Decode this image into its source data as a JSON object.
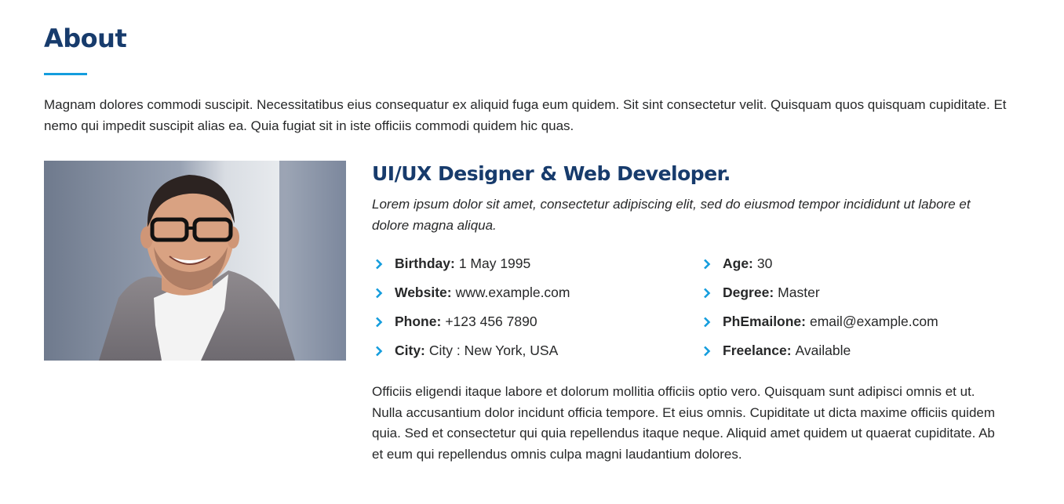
{
  "about": {
    "title": "About",
    "intro": "Magnam dolores commodi suscipit. Necessitatibus eius consequatur ex aliquid fuga eum quidem. Sit sint consectetur velit. Quisquam quos quisquam cupiditate. Et nemo qui impedit suscipit alias ea. Quia fugiat sit in iste officiis commodi quidem hic quas.",
    "role_title": "UI/UX Designer & Web Developer.",
    "role_lead": "Lorem ipsum dolor sit amet, consectetur adipiscing elit, sed do eiusmod tempor incididunt ut labore et dolore magna aliqua.",
    "details_left": [
      {
        "label": "Birthday:",
        "value": "1 May 1995"
      },
      {
        "label": "Website:",
        "value": "www.example.com"
      },
      {
        "label": "Phone:",
        "value": "+123 456 7890"
      },
      {
        "label": "City:",
        "value": "City : New York, USA"
      }
    ],
    "details_right": [
      {
        "label": "Age:",
        "value": "30"
      },
      {
        "label": "Degree:",
        "value": "Master"
      },
      {
        "label": "PhEmailone:",
        "value": "email@example.com"
      },
      {
        "label": "Freelance:",
        "value": "Available"
      }
    ],
    "outro": "Officiis eligendi itaque labore et dolorum mollitia officiis optio vero. Quisquam sunt adipisci omnis et ut. Nulla accusantium dolor incidunt officia tempore. Et eius omnis. Cupiditate ut dicta maxime officiis quidem quia. Sed et consectetur qui quia repellendus itaque neque. Aliquid amet quidem ut quaerat cupiditate. Ab et eum qui repellendus omnis culpa magni laudantium dolores."
  },
  "icons": {
    "detail_bullet": "chevron-right-icon",
    "photo": "profile-photo"
  },
  "colors": {
    "heading": "#173b6c",
    "accent": "#149ddd",
    "text": "#272829"
  }
}
